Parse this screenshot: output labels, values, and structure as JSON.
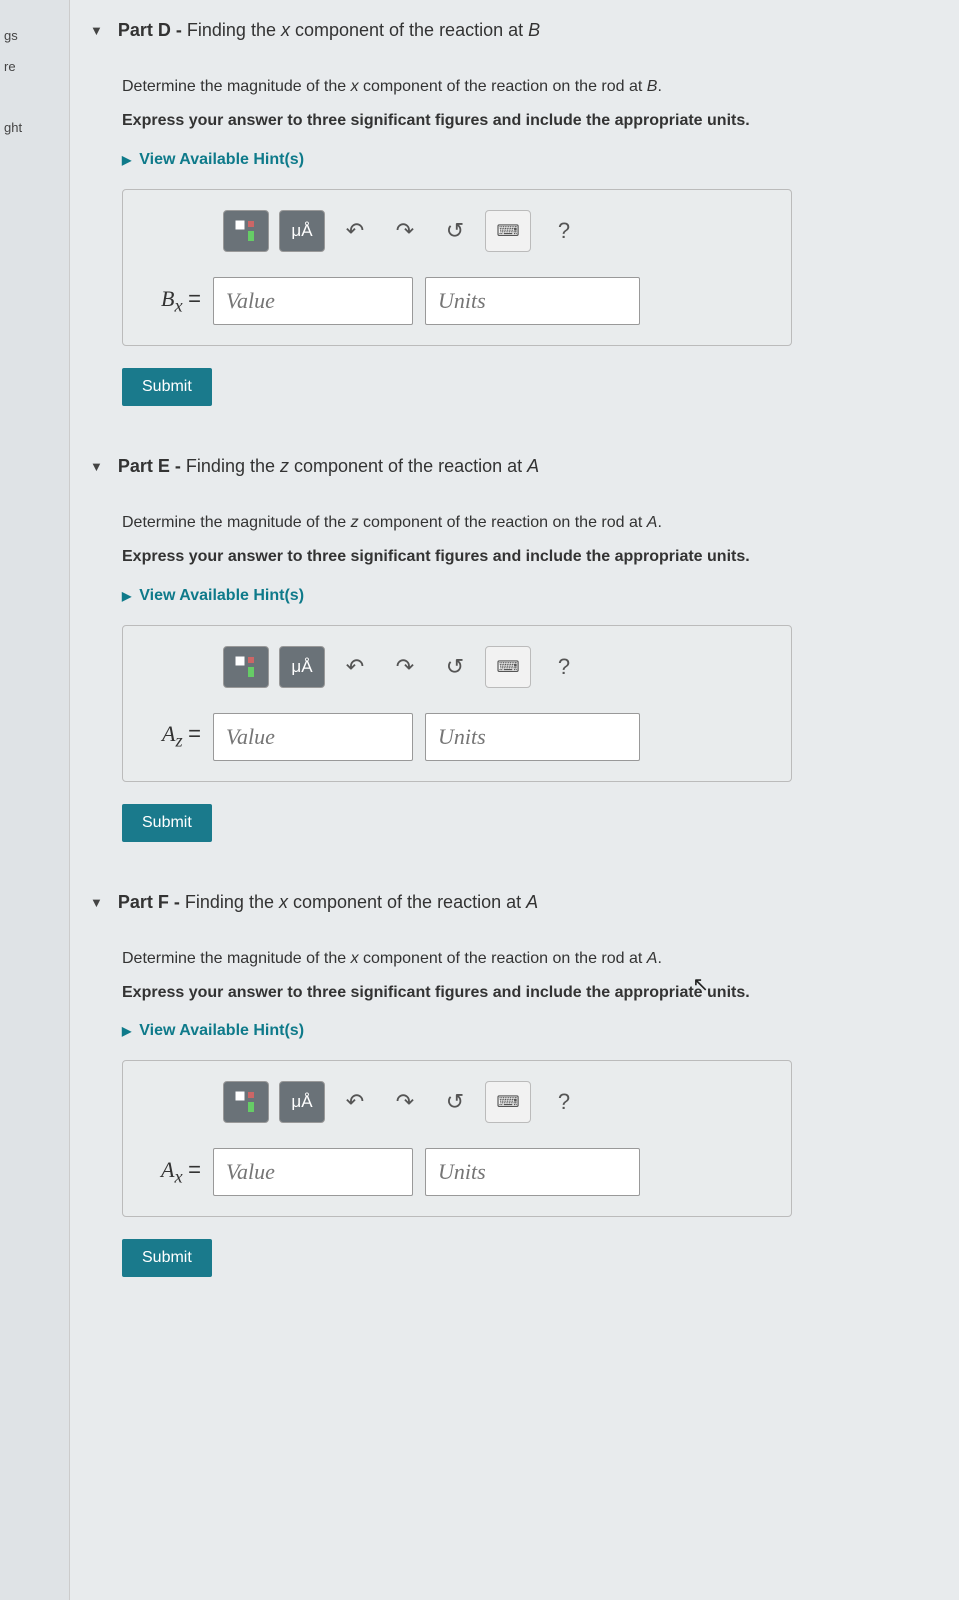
{
  "sidebar": {
    "items": [
      "gs",
      "re",
      "ght"
    ]
  },
  "parts": [
    {
      "letter": "D",
      "title_rest": "Finding the x component of the reaction at B",
      "title_italic_at": [
        "x",
        "B"
      ],
      "question": "Determine the magnitude of the x component of the reaction on the rod at B.",
      "question_italic": [
        "x",
        "B"
      ],
      "instruction": "Express your answer to three significant figures and include the appropriate units.",
      "hints": "View Available Hint(s)",
      "var": "Bₓ",
      "value_ph": "Value",
      "units_ph": "Units",
      "submit": "Submit"
    },
    {
      "letter": "E",
      "title_rest": "Finding the z component of the reaction at A",
      "question": "Determine the magnitude of the z component of the reaction on the rod at A.",
      "instruction": "Express your answer to three significant figures and include the appropriate units.",
      "hints": "View Available Hint(s)",
      "var": "A_z",
      "value_ph": "Value",
      "units_ph": "Units",
      "submit": "Submit"
    },
    {
      "letter": "F",
      "title_rest": "Finding the x component of the reaction at A",
      "question": "Determine the magnitude of the x component of the reaction on the rod at A.",
      "instruction": "Express your answer to three significant figures and include the appropriate units.",
      "hints": "View Available Hint(s)",
      "var": "Aₓ",
      "value_ph": "Value",
      "units_ph": "Units",
      "submit": "Submit"
    }
  ],
  "toolbar": {
    "templates": "templates",
    "units_symbol": "μÅ",
    "undo": "↶",
    "redo": "↷",
    "reset": "↺",
    "keyboard": "keyboard",
    "help": "?"
  }
}
